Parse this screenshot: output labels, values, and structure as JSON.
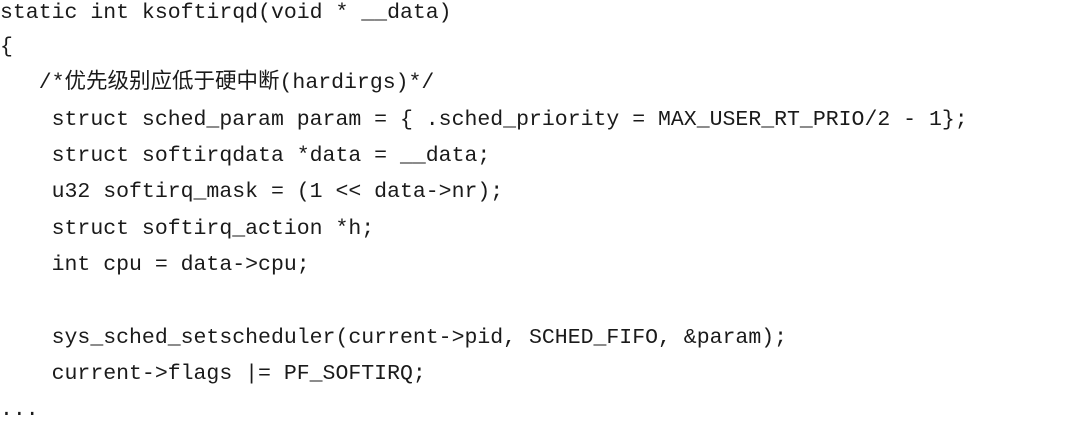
{
  "code": {
    "lines": [
      "static int ksoftirqd(void * __data)",
      "{",
      "   /*优先级别应低于硬中断(hardirgs)*/",
      "    struct sched_param param = { .sched_priority = MAX_USER_RT_PRIO/2 - 1};",
      "    struct softirqdata *data = __data;",
      "    u32 softirq_mask = (1 << data->nr);",
      "    struct softirq_action *h;",
      "    int cpu = data->cpu;",
      "",
      "    sys_sched_setscheduler(current->pid, SCHED_FIFO, &param);",
      "    current->flags |= PF_SOFTIRQ;",
      "..."
    ]
  }
}
